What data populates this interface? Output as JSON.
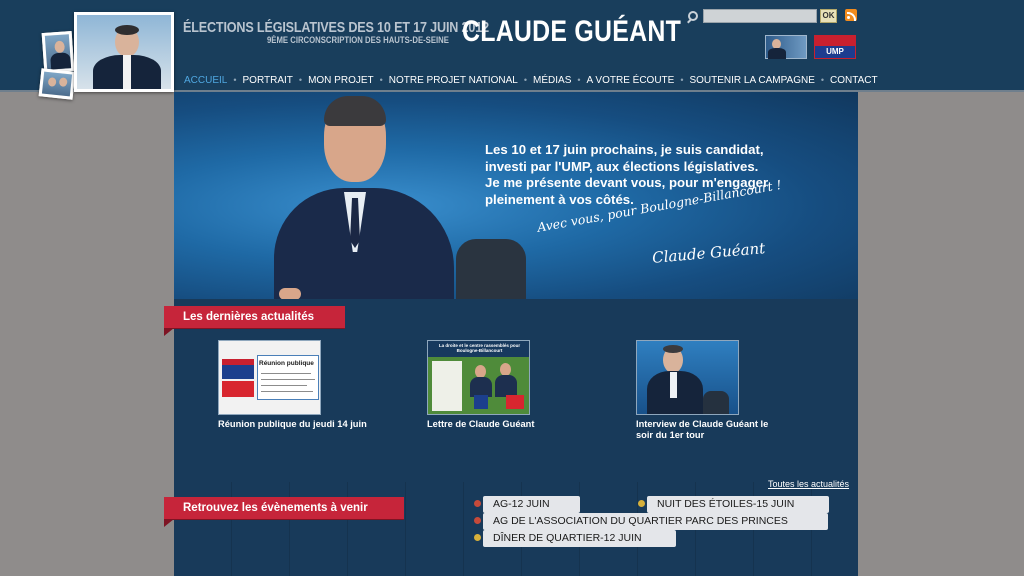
{
  "header": {
    "tagline_line1": "ÉLECTIONS LÉGISLATIVES DES 10 ET 17 JUIN 2012",
    "tagline_line2": "9ÈME CIRCONSCRIPTION DES HAUTS-DE-SEINE",
    "brand": "CLAUDE GUÉANT",
    "search": {
      "value": "",
      "button_label": "OK"
    },
    "icons": [
      "search-icon",
      "rss-icon",
      "ump-logo"
    ],
    "ump_label": "UMP"
  },
  "nav": {
    "items": [
      {
        "label": "ACCUEIL",
        "active": true
      },
      {
        "label": "PORTRAIT",
        "active": false
      },
      {
        "label": "MON PROJET",
        "active": false
      },
      {
        "label": "NOTRE PROJET NATIONAL",
        "active": false
      },
      {
        "label": "MÉDIAS",
        "active": false
      },
      {
        "label": "A VOTRE ÉCOUTE",
        "active": false
      },
      {
        "label": "SOUTENIR LA CAMPAGNE",
        "active": false
      },
      {
        "label": "CONTACT",
        "active": false
      }
    ],
    "separator": "•"
  },
  "hero": {
    "lines": [
      "Les 10 et 17 juin prochains,  je suis candidat,",
      "investi par l'UMP, aux élections législatives.",
      "Je me présente devant vous, pour m'engager",
      "pleinement à vos côtés."
    ],
    "signature_line1": "Avec vous, pour Boulogne-Billancourt !",
    "signature_line2": "Claude Guéant"
  },
  "news": {
    "title": "Les dernières actualités",
    "all_link": "Toutes les actualités",
    "items": [
      {
        "caption": "Réunion publique du jeudi 14 juin",
        "thumb_title": "Réunion publique",
        "thumb_ump": "UMP",
        "thumb_centre": "Le Nouveau Centre"
      },
      {
        "caption": "Lettre de Claude Guéant",
        "thumb_title": "La droite et le centre rassemblés pour Boulogne-Billancourt"
      },
      {
        "caption": "Interview de Claude Guéant le soir du 1er tour"
      }
    ]
  },
  "events": {
    "title": "Retrouvez les évènements à venir",
    "items": [
      {
        "label": "AG-12 JUIN",
        "color": "#c64a3a"
      },
      {
        "label": "NUIT DES ÉTOILES-15 JUIN",
        "color": "#d6b03b"
      },
      {
        "label": "AG DE L'ASSOCIATION DU QUARTIER PARC DES PRINCES",
        "color": "#c64a3a"
      },
      {
        "label": "DÎNER DE QUARTIER-12 JUIN",
        "color": "#d6b03b"
      }
    ]
  },
  "colors": {
    "header_bg": "#193e5c",
    "section_red": "#c6253a",
    "nav_active": "#4fa7e0",
    "page_bg": "#8f8c8b",
    "main_bg": "#183a5a"
  }
}
